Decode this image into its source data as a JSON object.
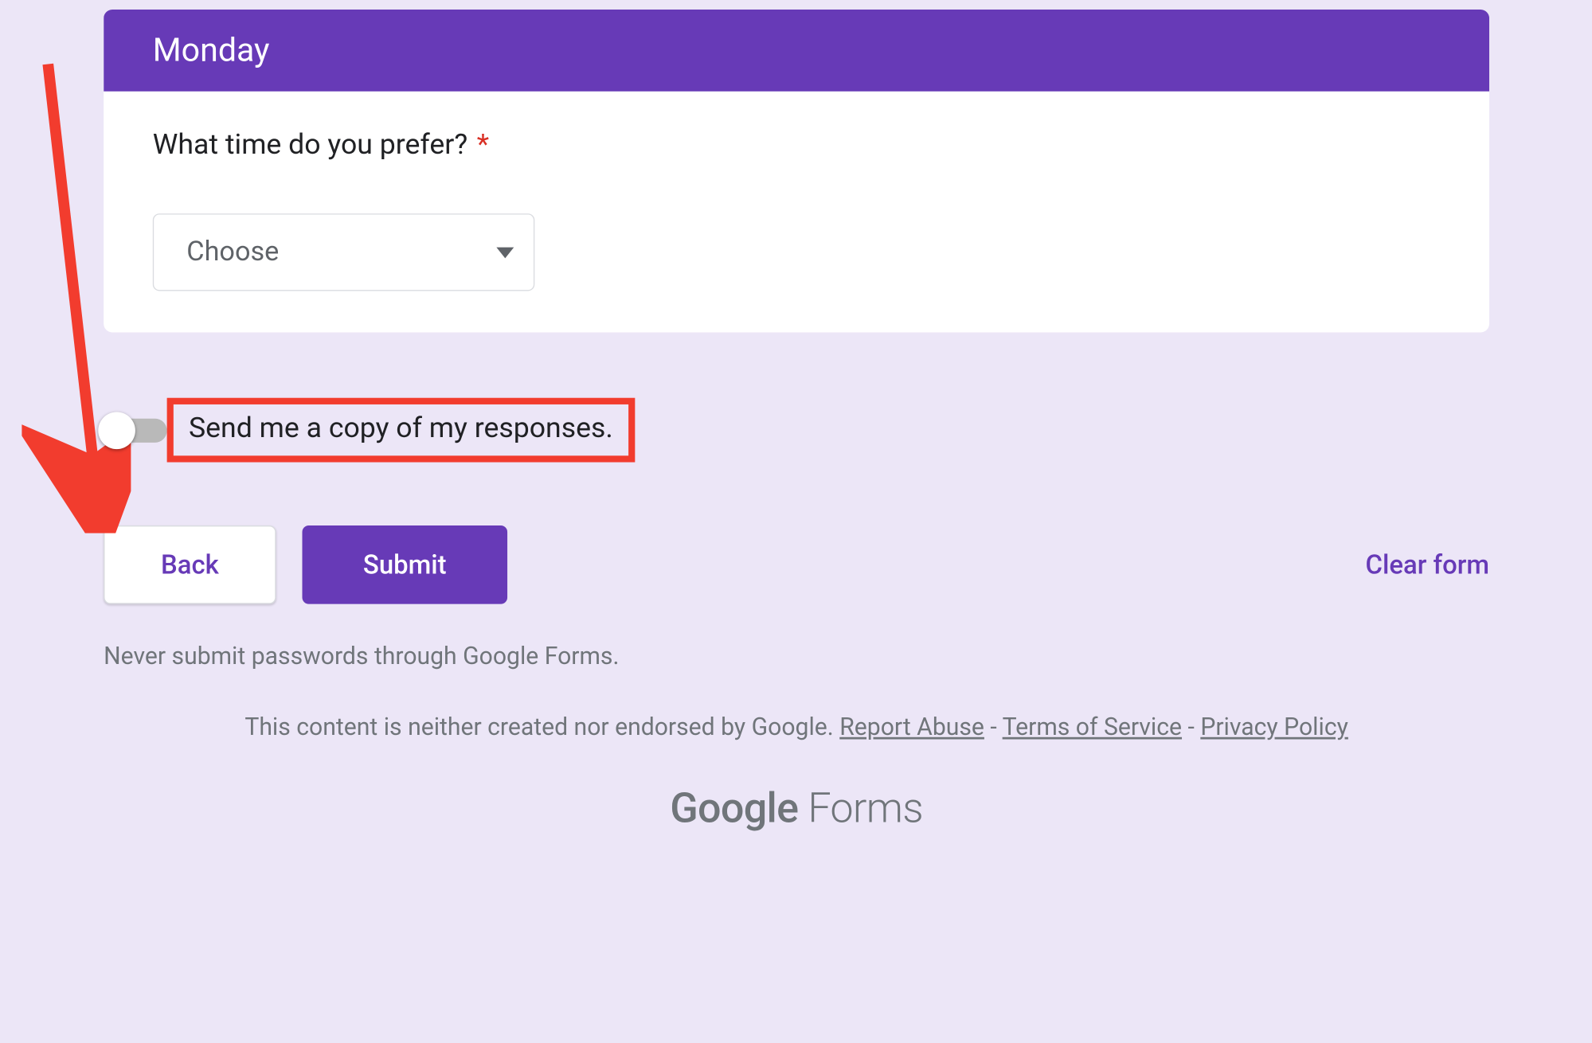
{
  "section": {
    "title": "Monday",
    "question": "What time do you prefer?",
    "required_marker": "*",
    "dropdown": {
      "selected_label": "Choose"
    }
  },
  "toggle": {
    "label": "Send me a copy of my responses.",
    "state": "off"
  },
  "actions": {
    "back": "Back",
    "submit": "Submit",
    "clear": "Clear form"
  },
  "footer": {
    "warning": "Never submit passwords through Google Forms.",
    "disclaimer_text": "This content is neither created nor endorsed by Google.",
    "report_abuse": "Report Abuse",
    "sep": " - ",
    "terms": "Terms of Service",
    "privacy": "Privacy Policy",
    "brand_google": "Google",
    "brand_forms": " Forms"
  },
  "annotation": {
    "highlight_color": "#f23c2e"
  }
}
